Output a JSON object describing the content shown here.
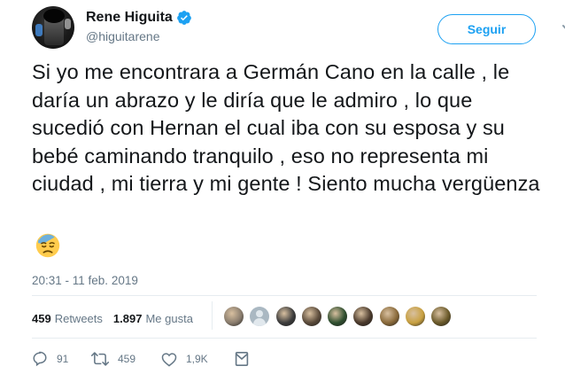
{
  "author": {
    "display_name": "Rene Higuita",
    "handle": "@higuitarene",
    "verified": true
  },
  "follow_button_label": "Seguir",
  "tweet": {
    "text": "Si yo me encontrara a Germán Cano en la calle , le daría un abrazo y le diría que le admiro , lo que sucedió con Hernan el cual iba con su esposa y su bebé caminando tranquilo , eso no representa mi ciudad , mi tierra y mi gente ! Siento mucha vergüenza",
    "emoji": "downcast-face-with-sweat",
    "timestamp": "20:31 - 11 feb. 2019"
  },
  "stats": {
    "retweets_count": "459",
    "retweets_label": "Retweets",
    "likes_count": "1.897",
    "likes_label": "Me gusta"
  },
  "likers": [
    {
      "name": "liker-1",
      "color": "#8a7d6e"
    },
    {
      "name": "liker-2",
      "color": "#aab8c2"
    },
    {
      "name": "liker-3",
      "color": "#3d3d3d"
    },
    {
      "name": "liker-4",
      "color": "#5a4a3a"
    },
    {
      "name": "liker-5",
      "color": "#2f4f2f"
    },
    {
      "name": "liker-6",
      "color": "#4b3a2c"
    },
    {
      "name": "liker-7",
      "color": "#8a6a3a"
    },
    {
      "name": "liker-8",
      "color": "#c8a040"
    },
    {
      "name": "liker-9",
      "color": "#6b5a2a"
    }
  ],
  "actions": {
    "reply_count": "91",
    "retweet_count": "459",
    "like_count": "1,9K"
  },
  "colors": {
    "accent": "#1da1f2",
    "text": "#14171a",
    "muted": "#657786",
    "border": "#e6ecf0"
  }
}
